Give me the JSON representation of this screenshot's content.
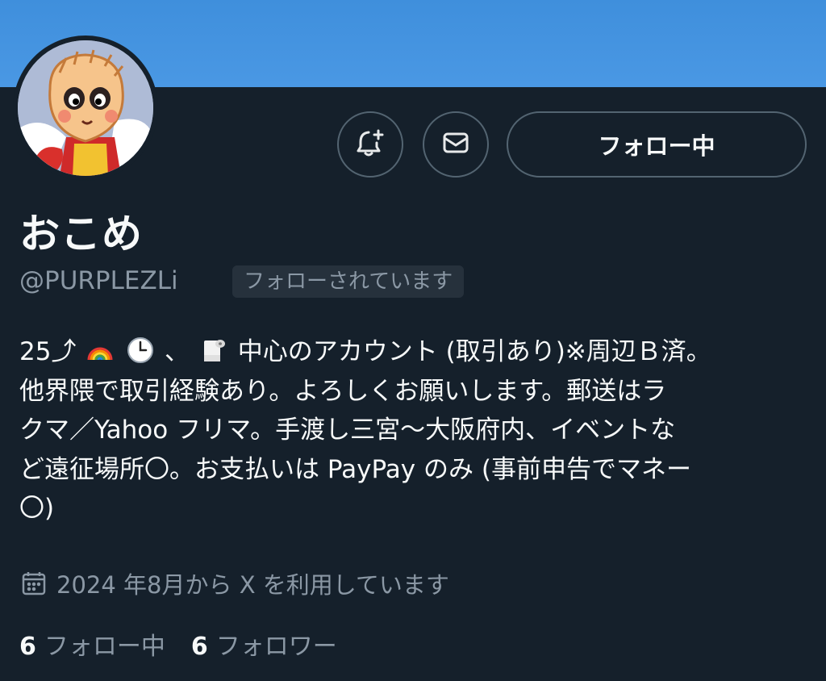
{
  "profile": {
    "display_name": "おこめ",
    "handle": "@PURPLEZLi",
    "follows_you_badge": "フォローされています",
    "avatar_icon": "character-avatar-icon",
    "banner_color": "#4a98e4"
  },
  "actions": {
    "notify_icon": "bell-plus-icon",
    "message_icon": "mail-icon",
    "follow_label": "フォロー中"
  },
  "bio": {
    "line1_a": "25⤴",
    "line1_b": "、",
    "line1_c": "中心のアカウント (取引あり)※周辺Ｂ済。",
    "line2": "他界隈で取引経験あり。よろしくお願いします。郵送はラ",
    "line3": "クマ／Yahoo フリマ。手渡し三宮〜大阪府内、イベントな",
    "line4": "ど遠征場所〇。お支払いは PayPay のみ (事前申告でマネー",
    "line5": "〇)",
    "emojis": [
      "rainbow-icon",
      "clock-icon",
      "toilet-paper-icon"
    ]
  },
  "joined": {
    "icon": "calendar-icon",
    "text": "2024 年8月から X を利用しています"
  },
  "stats": {
    "following_count": "6",
    "following_label": "フォロー中",
    "followers_count": "6",
    "followers_label": "フォロワー"
  },
  "colors": {
    "background": "#15202b",
    "secondary_text": "#8b98a5",
    "border": "#536471"
  }
}
